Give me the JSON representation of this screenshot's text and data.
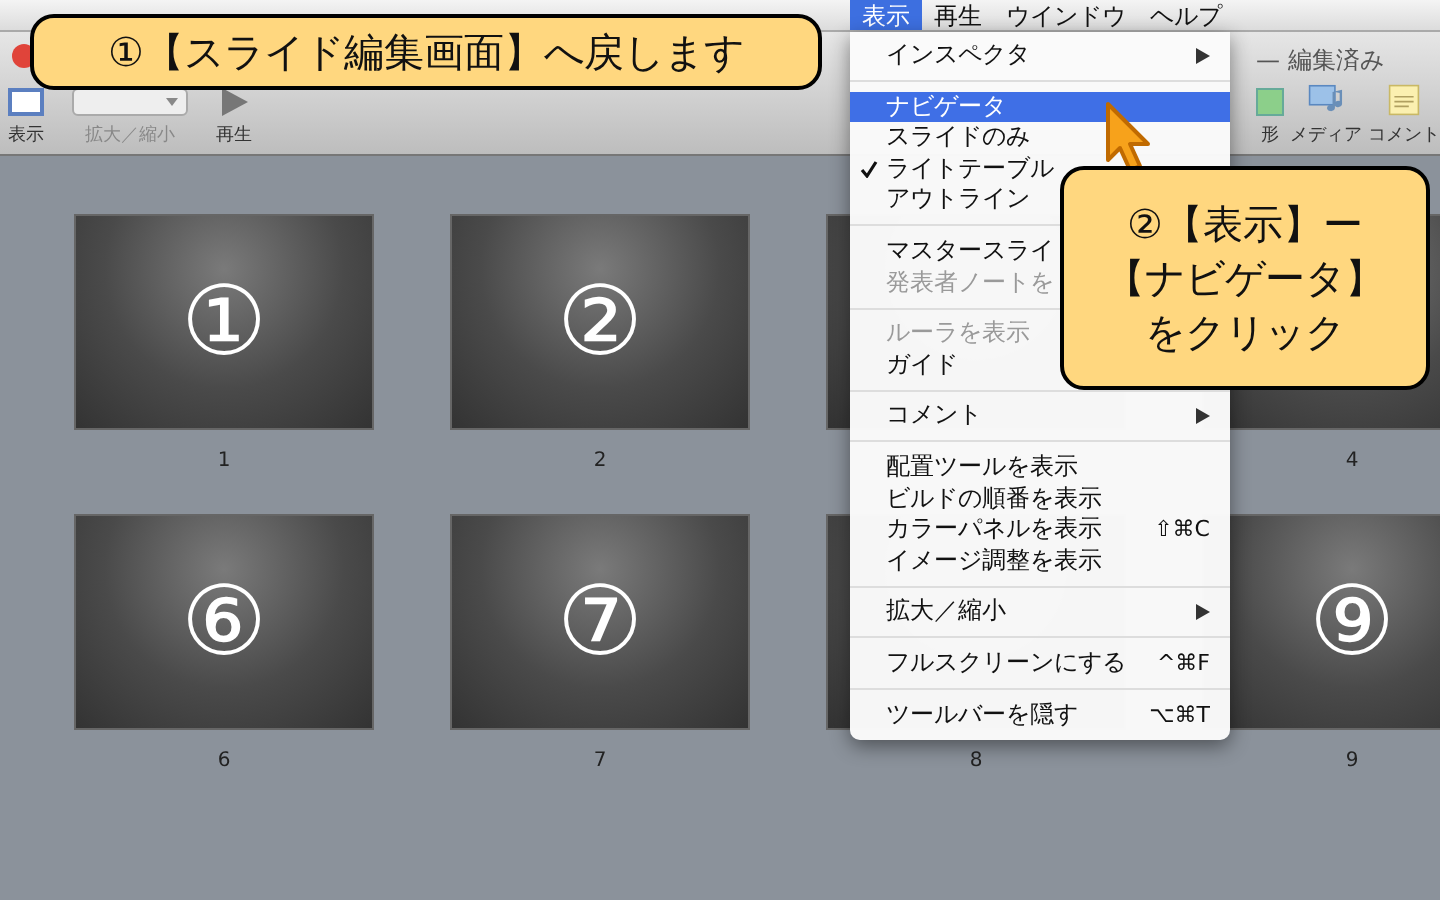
{
  "menu_bar": [
    {
      "label": "表示",
      "selected": true
    },
    {
      "label": "再生",
      "selected": false
    },
    {
      "label": "ウインドウ",
      "selected": false
    },
    {
      "label": "ヘルプ",
      "selected": false
    }
  ],
  "window": {
    "title": "— 編集済み"
  },
  "toolbar": {
    "left": [
      {
        "kind": "view",
        "label": "表示"
      },
      {
        "kind": "zoom",
        "label": "拡大／縮小"
      },
      {
        "kind": "play",
        "label": "再生"
      }
    ],
    "right": [
      {
        "kind": "shape",
        "label": "形"
      },
      {
        "kind": "media",
        "label": "メディア"
      },
      {
        "kind": "comment",
        "label": "コメント"
      }
    ]
  },
  "slides": [
    {
      "kind": "slide",
      "label": "1",
      "glyph": "①"
    },
    {
      "kind": "slide",
      "label": "2",
      "glyph": "②"
    },
    {
      "kind": "covered"
    },
    {
      "kind": "slide",
      "label": "4"
    },
    {
      "kind": "slide",
      "label": "6",
      "glyph": "⑥"
    },
    {
      "kind": "slide",
      "label": "7",
      "glyph": "⑦"
    },
    {
      "kind": "slide",
      "label": "8"
    },
    {
      "kind": "slide",
      "label": "9",
      "glyph": "⑨"
    }
  ],
  "menu": [
    {
      "kind": "item",
      "label": "インスペクタ",
      "submenu": true,
      "selected": false,
      "checked": false,
      "disabled": false
    },
    {
      "kind": "separator"
    },
    {
      "kind": "item",
      "label": "ナビゲータ",
      "submenu": false,
      "selected": true,
      "checked": false,
      "disabled": false
    },
    {
      "kind": "item",
      "label": "スライドのみ",
      "submenu": false,
      "selected": false,
      "checked": false,
      "disabled": false
    },
    {
      "kind": "item",
      "label": "ライトテーブル",
      "submenu": false,
      "selected": false,
      "checked": true,
      "disabled": false
    },
    {
      "kind": "item",
      "label": "アウトライン",
      "selected": false,
      "checked": false,
      "disabled": false
    },
    {
      "kind": "separator"
    },
    {
      "kind": "item",
      "label": "マスタースライ",
      "selected": false,
      "checked": false,
      "disabled": false
    },
    {
      "kind": "item",
      "label": "発表者ノートを",
      "submenu": false,
      "selected": false,
      "checked": false,
      "disabled": true
    },
    {
      "kind": "separator"
    },
    {
      "kind": "item",
      "label": "ルーラを表示",
      "submenu": false,
      "selected": false,
      "checked": false,
      "disabled": true
    },
    {
      "kind": "item",
      "label": "ガイド",
      "selected": false,
      "checked": false,
      "disabled": false
    },
    {
      "kind": "separator"
    },
    {
      "kind": "item",
      "label": "コメント",
      "submenu": true,
      "selected": false,
      "checked": false,
      "disabled": false
    },
    {
      "kind": "separator"
    },
    {
      "kind": "item",
      "label": "配置ツールを表示",
      "submenu": false,
      "selected": false,
      "checked": false,
      "disabled": false
    },
    {
      "kind": "item",
      "label": "ビルドの順番を表示",
      "submenu": false,
      "selected": false,
      "checked": false,
      "disabled": false
    },
    {
      "kind": "item",
      "label": "カラーパネルを表示",
      "shortcut": "⇧⌘C",
      "submenu": false,
      "selected": false,
      "checked": false,
      "disabled": false
    },
    {
      "kind": "item",
      "label": "イメージ調整を表示",
      "submenu": false,
      "selected": false,
      "checked": false,
      "disabled": false
    },
    {
      "kind": "separator"
    },
    {
      "kind": "item",
      "label": "拡大／縮小",
      "submenu": true,
      "selected": false,
      "checked": false,
      "disabled": false
    },
    {
      "kind": "separator"
    },
    {
      "kind": "item",
      "label": "フルスクリーンにする",
      "shortcut": "^⌘F",
      "submenu": false,
      "selected": false,
      "checked": false,
      "disabled": false
    },
    {
      "kind": "separator"
    },
    {
      "kind": "item",
      "label": "ツールバーを隠す",
      "shortcut": "⌥⌘T",
      "submenu": false,
      "selected": false,
      "checked": false,
      "disabled": false
    }
  ],
  "callouts": [
    {
      "lines": [
        "①【スライド編集画面】へ戻します"
      ]
    },
    {
      "lines": [
        "②【表示】ー",
        "【ナビゲータ】",
        "をクリック"
      ]
    }
  ]
}
